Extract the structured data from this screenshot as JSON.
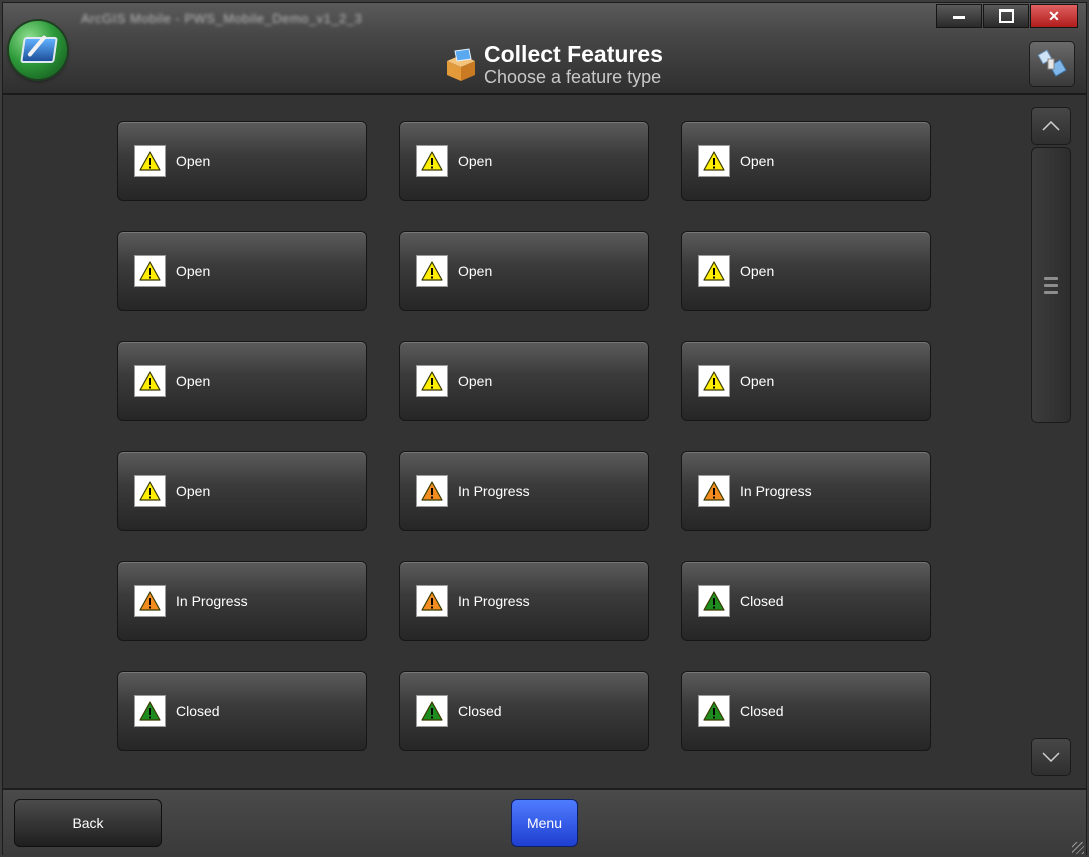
{
  "window": {
    "caption": "ArcGIS Mobile - PWS_Mobile_Demo_v1_2_3",
    "controls": {
      "minimize_icon": "minimize-icon",
      "maximize_icon": "maximize-icon",
      "close_label": "✕"
    }
  },
  "header": {
    "title": "Collect Features",
    "subtitle": "Choose a feature type"
  },
  "feature_types": [
    {
      "label": "Open",
      "status": "open"
    },
    {
      "label": "Open",
      "status": "open"
    },
    {
      "label": "Open",
      "status": "open"
    },
    {
      "label": "Open",
      "status": "open"
    },
    {
      "label": "Open",
      "status": "open"
    },
    {
      "label": "Open",
      "status": "open"
    },
    {
      "label": "Open",
      "status": "open"
    },
    {
      "label": "Open",
      "status": "open"
    },
    {
      "label": "Open",
      "status": "open"
    },
    {
      "label": "Open",
      "status": "open"
    },
    {
      "label": "In Progress",
      "status": "in-progress"
    },
    {
      "label": "In Progress",
      "status": "in-progress"
    },
    {
      "label": "In Progress",
      "status": "in-progress"
    },
    {
      "label": "In Progress",
      "status": "in-progress"
    },
    {
      "label": "Closed",
      "status": "closed"
    },
    {
      "label": "Closed",
      "status": "closed"
    },
    {
      "label": "Closed",
      "status": "closed"
    },
    {
      "label": "Closed",
      "status": "closed"
    }
  ],
  "status_colors": {
    "open": "#ffee00",
    "in-progress": "#f28c1e",
    "closed": "#1e8c1e"
  },
  "footer": {
    "back_label": "Back",
    "menu_label": "Menu"
  },
  "accent_color": "#2f55f0"
}
